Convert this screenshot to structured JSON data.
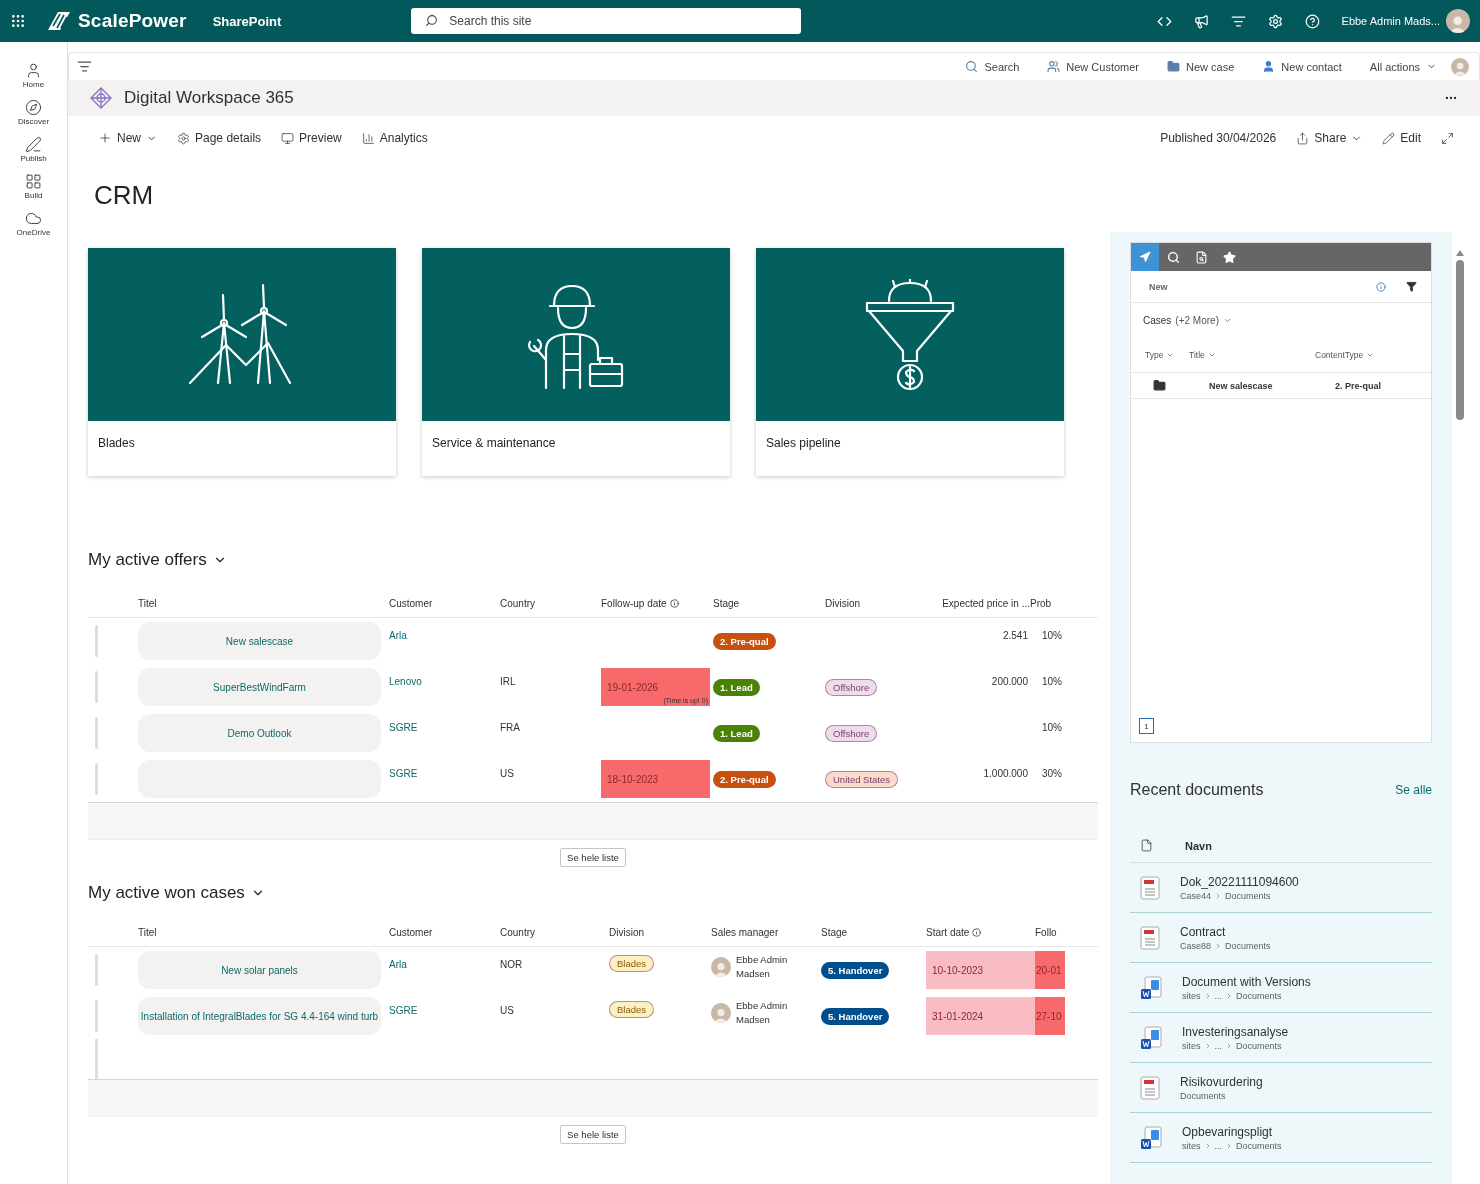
{
  "suite_bar": {
    "brand": "ScalePower",
    "app": "SharePoint",
    "search_placeholder": "Search this site",
    "user": "Ebbe Admin Mads..."
  },
  "left_rail": [
    {
      "kind": "home",
      "label": "Home"
    },
    {
      "kind": "discover",
      "label": "Discover"
    },
    {
      "kind": "publish",
      "label": "Publish"
    },
    {
      "kind": "build",
      "label": "Build"
    },
    {
      "kind": "onedrive",
      "label": "OneDrive"
    }
  ],
  "command_bar": [
    {
      "kind": "search",
      "label": "Search"
    },
    {
      "kind": "customer",
      "label": "New Customer"
    },
    {
      "kind": "case",
      "label": "New case"
    },
    {
      "kind": "contact",
      "label": "New contact"
    },
    {
      "kind": "menu",
      "label": "All actions"
    }
  ],
  "site": {
    "title": "Digital Workspace 365"
  },
  "page_toolbar": {
    "items": [
      {
        "kind": "new",
        "label": "New"
      },
      {
        "kind": "details",
        "label": "Page details"
      },
      {
        "kind": "preview",
        "label": "Preview"
      },
      {
        "kind": "analytics",
        "label": "Analytics"
      }
    ],
    "published": "Published 30/04/2026",
    "share": "Share",
    "edit": "Edit"
  },
  "page_title": "CRM",
  "tiles": [
    {
      "kind": "turbines",
      "label": "Blades"
    },
    {
      "kind": "worker",
      "label": "Service & maintenance"
    },
    {
      "kind": "funnel",
      "label": "Sales pipeline"
    }
  ],
  "offers": {
    "title": "My active offers",
    "columns": [
      "Titel",
      "Customer",
      "Country",
      "Follow-up date",
      "Stage",
      "Division",
      "Expected price in ...",
      "Prob"
    ],
    "rows": [
      {
        "title": "New salescase",
        "customer": "Arla",
        "stage": {
          "text": "2. Pre-qual",
          "color": "#ca5010"
        },
        "price": "2.541",
        "prob": "10%"
      },
      {
        "title": "SuperBestWindFarm",
        "customer": "Lenovo",
        "country": "IRL",
        "followup": {
          "text": "19-01-2026",
          "note": "(Time is up! 0)",
          "color": "#f8696b"
        },
        "stage": {
          "text": "1. Lead",
          "color": "#498205"
        },
        "division": {
          "text": "Offshore",
          "color": "#eedcee"
        },
        "price": "200.000",
        "prob": "10%"
      },
      {
        "title": "Demo Outlook",
        "customer": "SGRE",
        "country": "FRA",
        "stage": {
          "text": "1. Lead",
          "color": "#498205"
        },
        "division": {
          "text": "Offshore",
          "color": "#eedcee"
        },
        "prob": "10%"
      },
      {
        "customer": "SGRE",
        "country": "US",
        "followup": {
          "text": "18-10-2023",
          "color": "#f8696b"
        },
        "stage": {
          "text": "2. Pre-qual",
          "color": "#ca5010"
        },
        "division": {
          "text": "United States",
          "color": "#fcdacb"
        },
        "price": "1.000.000",
        "prob": "30%"
      }
    ],
    "button": "Se hele liste"
  },
  "won_cases": {
    "title": "My active won cases",
    "columns": [
      "Titel",
      "Customer",
      "Country",
      "Division",
      "Sales manager",
      "Stage",
      "Start date",
      "Follo"
    ],
    "rows": [
      {
        "title": "New solar panels",
        "customer": "Arla",
        "country": "NOR",
        "division": {
          "text": "Blades",
          "color": "#fdefc3"
        },
        "manager": "Ebbe Admin Madsen",
        "stage": {
          "text": "5. Handover",
          "color": "#004e8c"
        },
        "start": {
          "text": "10-10-2023",
          "color": "#f9bcc3"
        },
        "follow": {
          "text": "20-01",
          "color": "#f8696b"
        }
      },
      {
        "title": "Installation of IntegralBlades for SG 4.4-164 wind turb",
        "customer": "SGRE",
        "country": "US",
        "division": {
          "text": "Blades",
          "color": "#fdefc3"
        },
        "manager": "Ebbe Admin Madsen",
        "stage": {
          "text": "5. Handover",
          "color": "#004e8c"
        },
        "start": {
          "text": "31-01-2024",
          "color": "#f9bcc3"
        },
        "follow": {
          "text": "27-10",
          "color": "#f8696b"
        }
      }
    ],
    "button": "Se hele liste"
  },
  "side_panel": {
    "tabs": [
      {
        "kind": "navigate",
        "selected": true
      },
      {
        "kind": "search",
        "selected": false
      },
      {
        "kind": "document",
        "selected": false
      },
      {
        "kind": "favorite",
        "selected": false
      }
    ],
    "new": "New",
    "view": "Cases",
    "view_more": "(+2 More)",
    "columns": [
      "Type",
      "Title",
      "ContentType"
    ],
    "rows": [
      {
        "title": "New salescase",
        "content_type": "2. Pre-qual"
      }
    ],
    "page": "1"
  },
  "recent_documents": {
    "title": "Recent documents",
    "see_all": "Se alle",
    "header": "Navn",
    "items": [
      {
        "kind": "pdf",
        "name": "Dok_20221111094600",
        "path": [
          "Case44",
          "Documents"
        ]
      },
      {
        "kind": "pdf",
        "name": "Contract",
        "path": [
          "Case88",
          "Documents"
        ]
      },
      {
        "kind": "word",
        "name": "Document with Versions",
        "path": [
          "sites",
          "...",
          "Documents"
        ]
      },
      {
        "kind": "word",
        "name": "Investeringsanalyse",
        "path": [
          "sites",
          "...",
          "Documents"
        ]
      },
      {
        "kind": "pdf",
        "name": "Risikovurdering",
        "path": [
          "Documents"
        ]
      },
      {
        "kind": "word",
        "name": "Opbevaringspligt",
        "path": [
          "sites",
          "...",
          "Documents"
        ]
      }
    ]
  }
}
